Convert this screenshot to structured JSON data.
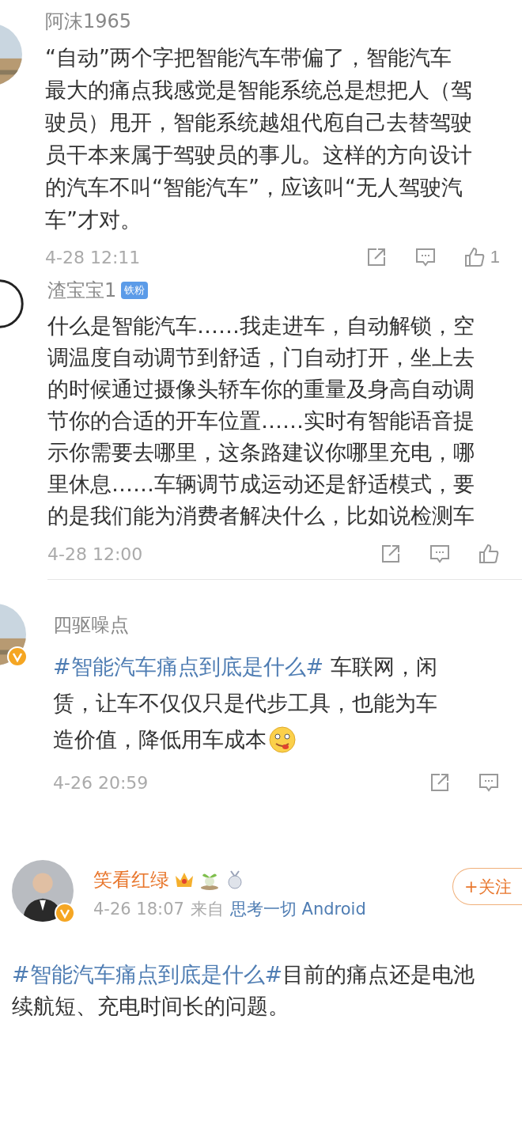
{
  "comments": [
    {
      "verified": false,
      "vip": false,
      "name": "阿沫1965",
      "lines": [
        [
          {
            "kind": "text",
            "text": "“自动”两个字把智能汽车带偏了，智能汽车"
          }
        ],
        [
          {
            "kind": "text",
            "text": "最大的痛点我感觉是智能系统总是想把人（驾"
          }
        ],
        [
          {
            "kind": "text",
            "text": "驶员）甩开，智能系统越俎代庖自己去替驾驶"
          }
        ],
        [
          {
            "kind": "text",
            "text": "员干本来属于驾驶员的事儿。这样的方向设计"
          }
        ],
        [
          {
            "kind": "text",
            "text": "的汽车不叫“智能汽车”，应该叫“无人驾驶汽"
          }
        ],
        [
          {
            "kind": "text",
            "text": "车”才对。"
          }
        ]
      ],
      "time": "4-28 12:11",
      "divider": false,
      "actions": [
        {
          "kind": "share"
        },
        {
          "kind": "comment"
        },
        {
          "kind": "like",
          "count": "1"
        }
      ]
    },
    {
      "verified": false,
      "vip": false,
      "name": "渣宝宝1",
      "badges": [
        {
          "kind": "label",
          "text": "铁粉"
        }
      ],
      "lines": [
        [
          {
            "kind": "text",
            "text": "什么是智能汽车……我走进车，自动解锁，空"
          }
        ],
        [
          {
            "kind": "text",
            "text": "调温度自动调节到舒适，门自动打开，坐上去"
          }
        ],
        [
          {
            "kind": "text",
            "text": "的时候通过摄像头轿车你的重量及身高自动调"
          }
        ],
        [
          {
            "kind": "text",
            "text": "节你的合适的开车位置……实时有智能语音提"
          }
        ],
        [
          {
            "kind": "text",
            "text": "示你需要去哪里，这条路建议你哪里充电，哪"
          }
        ],
        [
          {
            "kind": "text",
            "text": "里休息……车辆调节成运动还是舒适模式，要"
          }
        ],
        [
          {
            "kind": "text",
            "text": "的是我们能为消费者解决什么，比如说检测车"
          }
        ]
      ],
      "time": "4-28 12:00",
      "divider": true,
      "actions": [
        {
          "kind": "share"
        },
        {
          "kind": "comment"
        },
        {
          "kind": "like"
        }
      ]
    },
    {
      "verified": true,
      "vip": false,
      "name": "四驱噪点",
      "lines": [
        [
          {
            "kind": "topic",
            "text": "#智能汽车痛点到底是什么#"
          },
          {
            "kind": "text",
            "text": " 车联网，闲"
          }
        ],
        [
          {
            "kind": "text",
            "text": "赁，让车不仅仅只是代步工具，也能为车"
          }
        ],
        [
          {
            "kind": "text",
            "text": "造价值，降低用车成本"
          },
          {
            "kind": "emoji"
          }
        ]
      ],
      "time": "4-26 20:59",
      "divider": false,
      "actions": [
        {
          "kind": "share"
        },
        {
          "kind": "comment"
        }
      ]
    },
    {
      "verified": true,
      "vip": true,
      "name": "笑看红绿",
      "badges": [
        {
          "kind": "crown"
        },
        {
          "kind": "sprout"
        },
        {
          "kind": "medal"
        }
      ],
      "source_prefix": "来自",
      "source": "思考一切 Android",
      "follow": "+关注",
      "lines": [
        [
          {
            "kind": "topic",
            "text": "#智能汽车痛点到底是什么#"
          },
          {
            "kind": "text",
            "text": "目前的痛点还是电池"
          }
        ],
        [
          {
            "kind": "text",
            "text": "续航短、充电时间长的问题。"
          }
        ]
      ],
      "time": "4-26 18:07",
      "divider": false
    }
  ]
}
